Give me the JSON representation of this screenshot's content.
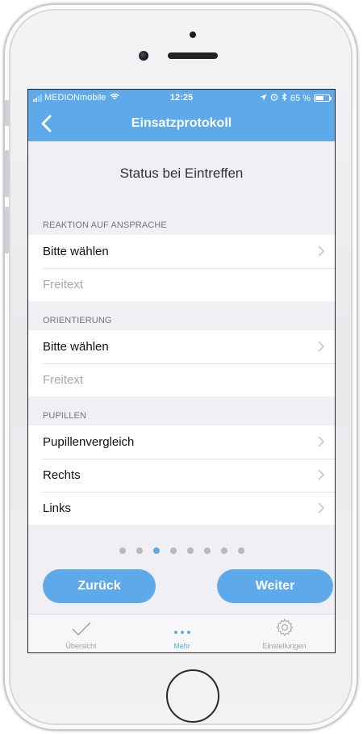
{
  "statusbar": {
    "carrier": "MEDIONmobile",
    "time": "12:25",
    "battery": "65 %",
    "battery_level": 0.65
  },
  "navbar": {
    "title": "Einsatzprotokoll",
    "back_icon": "chevron-left-icon"
  },
  "page": {
    "heading": "Status bei Eintreffen"
  },
  "sections": [
    {
      "header": "REAKTION AUF ANSPRACHE",
      "rows": [
        {
          "label": "Bitte wählen",
          "has_chevron": true
        },
        {
          "label": "Freitext",
          "placeholder": true
        }
      ]
    },
    {
      "header": "ORIENTIERUNG",
      "rows": [
        {
          "label": "Bitte wählen",
          "has_chevron": true
        },
        {
          "label": "Freitext",
          "placeholder": true
        }
      ]
    },
    {
      "header": "PUPILLEN",
      "rows": [
        {
          "label": "Pupillenvergleich",
          "has_chevron": true
        },
        {
          "label": "Rechts",
          "has_chevron": true
        },
        {
          "label": "Links",
          "has_chevron": true
        }
      ]
    }
  ],
  "pager": {
    "total": 8,
    "active_index": 2
  },
  "buttons": {
    "back_label": "Zurück",
    "next_label": "Weiter"
  },
  "tabbar": {
    "tabs": [
      {
        "label": "Übersicht",
        "icon": "checkmark-icon",
        "active": false
      },
      {
        "label": "Mehr",
        "icon": "more-icon",
        "active": true
      },
      {
        "label": "Einstellungen",
        "icon": "gear-icon",
        "active": false
      }
    ]
  },
  "colors": {
    "accent": "#5da9ea",
    "background": "#efeff4",
    "placeholder": "#a8a8ad"
  }
}
